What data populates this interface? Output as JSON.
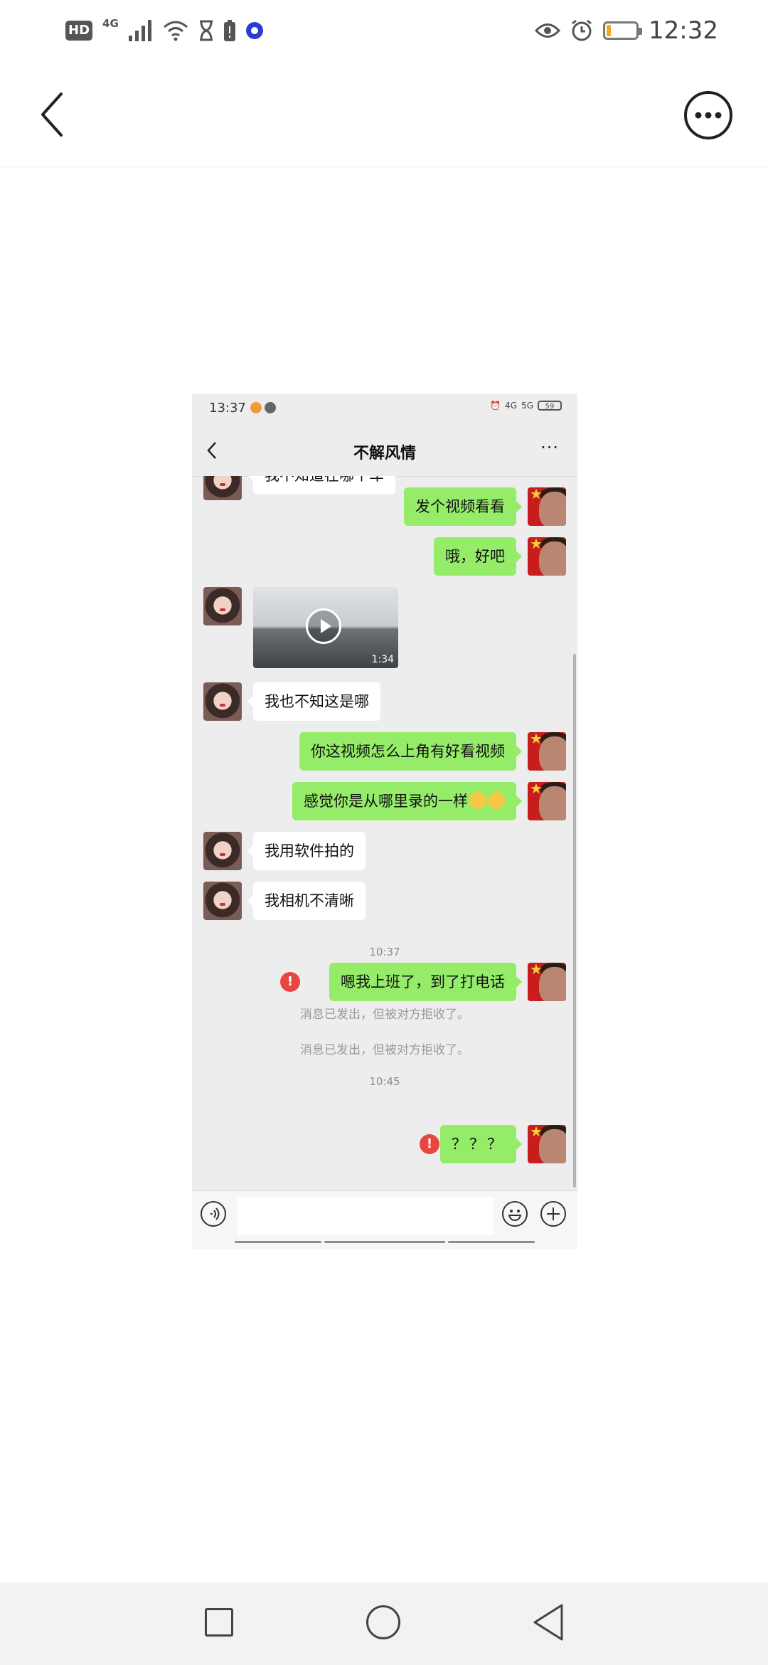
{
  "status_bar": {
    "hd": "HD",
    "network": "4G",
    "time": "12:32",
    "battery_level": 0.15,
    "battery_color": "#f5a623"
  },
  "header": {
    "back_icon": "chevron-left-icon",
    "more_icon": "more-circle-icon"
  },
  "screenshot": {
    "status": {
      "time": "13:37",
      "battery": "59",
      "network": "4G",
      "network2": "5G"
    },
    "title": "不解风情",
    "more": "···",
    "messages": [
      {
        "side": "left",
        "type": "text",
        "text": "我不知道在哪个车"
      },
      {
        "side": "right",
        "type": "text",
        "text": "发个视频看看"
      },
      {
        "side": "right",
        "type": "text",
        "text": "哦，好吧"
      },
      {
        "side": "left",
        "type": "video",
        "duration": "1:34"
      },
      {
        "side": "left",
        "type": "text",
        "text": "我也不知这是哪"
      },
      {
        "side": "right",
        "type": "text",
        "text": "你这视频怎么上角有好看视频"
      },
      {
        "side": "right",
        "type": "text",
        "text": "感觉你是从哪里录的一样"
      },
      {
        "side": "left",
        "type": "text",
        "text": "我用软件拍的"
      },
      {
        "side": "left",
        "type": "text",
        "text": "我相机不清晰"
      },
      {
        "type": "time",
        "text": "10:37"
      },
      {
        "side": "right",
        "type": "text",
        "text": "嗯我上班了，到了打电话",
        "failed": true
      },
      {
        "type": "system",
        "text": "消息已发出，但被对方拒收了。"
      },
      {
        "type": "system",
        "text": "消息已发出，但被对方拒收了。"
      },
      {
        "type": "time",
        "text": "10:45"
      },
      {
        "side": "right",
        "type": "text",
        "text": "？？？",
        "failed": true
      }
    ],
    "error_mark": "!",
    "bubble_green": "#95ec69",
    "error_color": "#e8463f"
  },
  "nav": {
    "recent_icon": "square-icon",
    "home_icon": "circle-icon",
    "back_icon": "triangle-back-icon"
  }
}
